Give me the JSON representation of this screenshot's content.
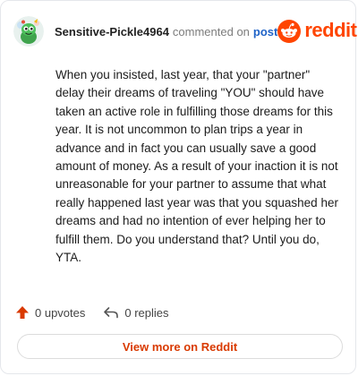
{
  "comment": {
    "author": "Sensitive-Pickle4964",
    "verb": "commented on",
    "post_link": "post",
    "body": "When you insisted, last year, that your \"partner\" delay their dreams of traveling \"YOU\" should have taken an active role in fulfilling those dreams for this year. It is not uncommon to plan trips a year in advance and in fact you can usually save a good amount of money. As a result of your inaction it is not unreasonable for your partner to assume that what really happened last year was that you squashed her dreams and had no intention of ever helping her to fulfill them. Do you understand that? Until you do, YTA."
  },
  "brand": {
    "name": "reddit",
    "color": "#ff4500",
    "icon": "reddit-snoo-icon"
  },
  "actions": {
    "upvotes_label": "0 upvotes",
    "replies_label": "0 replies",
    "upvote_icon": "upvote-arrow-icon",
    "reply_icon": "reply-arrow-icon",
    "upvote_color": "#d93a00"
  },
  "footer": {
    "view_more_label": "View more on Reddit"
  },
  "avatar": {
    "icon": "snoo-avatar-icon"
  }
}
